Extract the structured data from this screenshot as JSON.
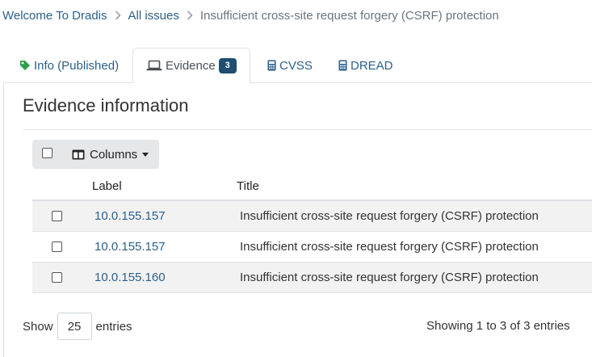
{
  "breadcrumb": {
    "items": [
      {
        "label": "Welcome To Dradis"
      },
      {
        "label": "All issues"
      },
      {
        "label": "Insufficient cross-site request forgery (CSRF) protection"
      }
    ]
  },
  "tabs": [
    {
      "label": "Info (Published)",
      "icon": "tag-icon",
      "active": false
    },
    {
      "label": "Evidence",
      "icon": "laptop-icon",
      "active": true,
      "badge": "3"
    },
    {
      "label": "CVSS",
      "icon": "calculator-icon",
      "active": false
    },
    {
      "label": "DREAD",
      "icon": "calculator-icon",
      "active": false
    }
  ],
  "section": {
    "title": "Evidence information"
  },
  "toolbar": {
    "columns_label": "Columns"
  },
  "table": {
    "headers": {
      "label": "Label",
      "title": "Title"
    },
    "rows": [
      {
        "label": "10.0.155.157",
        "title": "Insufficient cross-site request forgery (CSRF) protection"
      },
      {
        "label": "10.0.155.157",
        "title": "Insufficient cross-site request forgery (CSRF) protection"
      },
      {
        "label": "10.0.155.160",
        "title": "Insufficient cross-site request forgery (CSRF) protection"
      }
    ]
  },
  "footer": {
    "show_label": "Show",
    "page_size": "25",
    "entries_label": "entries",
    "summary": "Showing 1 to 3 of 3 entries"
  },
  "colors": {
    "link": "#2b5f8a",
    "badge": "#1f4e70",
    "tag_icon": "#2e9e4f"
  }
}
